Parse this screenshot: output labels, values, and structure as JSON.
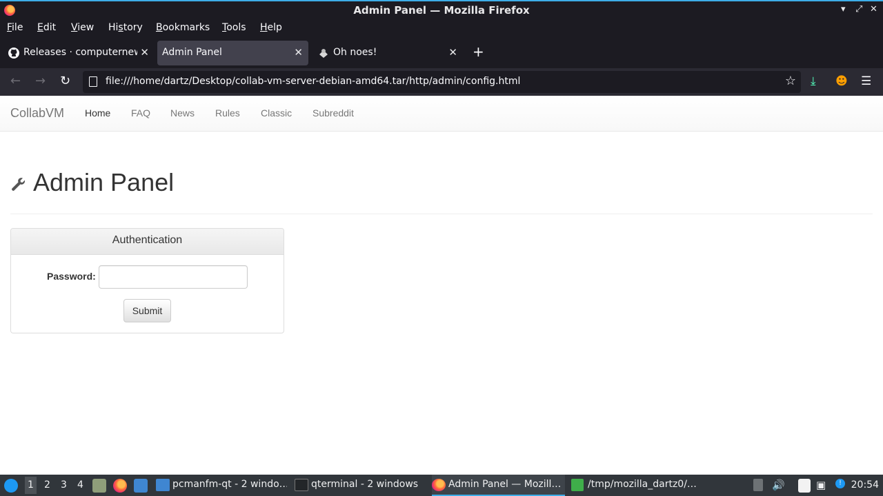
{
  "window": {
    "title": "Admin Panel — Mozilla Firefox"
  },
  "menubar": [
    {
      "label": "File",
      "key": "F",
      "rest": "ile"
    },
    {
      "label": "Edit",
      "key": "E",
      "rest": "dit"
    },
    {
      "label": "View",
      "key": "V",
      "rest": "iew"
    },
    {
      "label": "History",
      "pre": "Hi",
      "key": "s",
      "rest": "tory"
    },
    {
      "label": "Bookmarks",
      "key": "B",
      "rest": "ookmarks"
    },
    {
      "label": "Tools",
      "key": "T",
      "rest": "ools"
    },
    {
      "label": "Help",
      "key": "H",
      "rest": "elp"
    }
  ],
  "tabs": [
    {
      "label": "Releases · computernewb/collab-vm-server",
      "icon": "github-icon",
      "active": false
    },
    {
      "label": "Admin Panel",
      "icon": "",
      "active": true
    },
    {
      "label": "Oh noes!",
      "icon": "collabvm-icon",
      "active": false
    }
  ],
  "navbar": {
    "url": "file:///home/dartz/Desktop/collab-vm-server-debian-amd64.tar/http/admin/config.html"
  },
  "site": {
    "brand": "CollabVM",
    "nav": [
      "Home",
      "FAQ",
      "News",
      "Rules",
      "Classic",
      "Subreddit"
    ],
    "active_nav": "Home"
  },
  "page": {
    "title": "Admin Panel",
    "panel_heading": "Authentication",
    "password_label": "Password:",
    "password_value": "",
    "submit_label": "Submit"
  },
  "taskbar": {
    "workspaces": [
      "1",
      "2",
      "3",
      "4"
    ],
    "current_workspace": "1",
    "tasks": [
      {
        "label": "pcmanfm-qt - 2 windo…",
        "icon": "folder-icon"
      },
      {
        "label": "qterminal - 2 windows",
        "icon": "terminal-icon"
      },
      {
        "label": "Admin Panel — Mozill…",
        "icon": "firefox-icon"
      },
      {
        "label": "/tmp/mozilla_dartz0/…",
        "icon": "archive-icon"
      }
    ],
    "clock": "20:54"
  },
  "colors": {
    "accent": "#3daee9",
    "browser_chrome": "#1c1b22",
    "toolbar": "#2b2a33",
    "download_icon": "#54ffbd"
  }
}
